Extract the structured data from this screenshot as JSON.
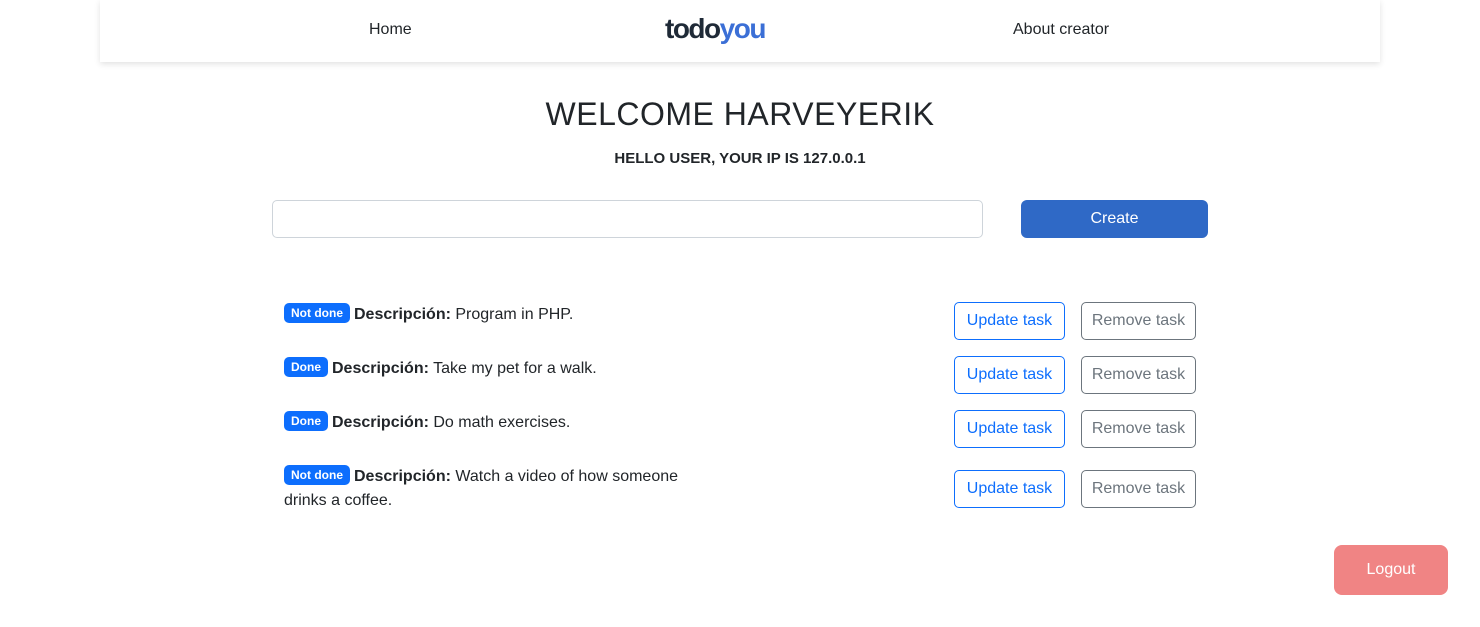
{
  "nav": {
    "home": "Home",
    "logo_part1": "todo",
    "logo_part2": "you",
    "about": "About creator"
  },
  "header": {
    "welcome": "WELCOME HARVEYERIK",
    "subtitle": "HELLO USER, YOUR IP IS 127.0.0.1"
  },
  "form": {
    "input_value": "",
    "create_label": "Create"
  },
  "tasks": [
    {
      "status": "Not done",
      "label": "Descripción:",
      "text": " Program in PHP.",
      "update_label": "Update task",
      "remove_label": "Remove task"
    },
    {
      "status": "Done",
      "label": "Descripción:",
      "text": " Take my pet for a walk.",
      "update_label": "Update task",
      "remove_label": "Remove task"
    },
    {
      "status": "Done",
      "label": "Descripción:",
      "text": " Do math exercises.",
      "update_label": "Update task",
      "remove_label": "Remove task"
    },
    {
      "status": "Not done",
      "label": "Descripción:",
      "text": " Watch a video of how someone drinks a coffee.",
      "update_label": "Update task",
      "remove_label": "Remove task"
    }
  ],
  "footer": {
    "logout_label": "Logout"
  },
  "colors": {
    "primary": "#0d6efd",
    "create_button": "#2f69c6",
    "logout_button": "#f08484",
    "logo_accent": "#3b6fd6"
  }
}
